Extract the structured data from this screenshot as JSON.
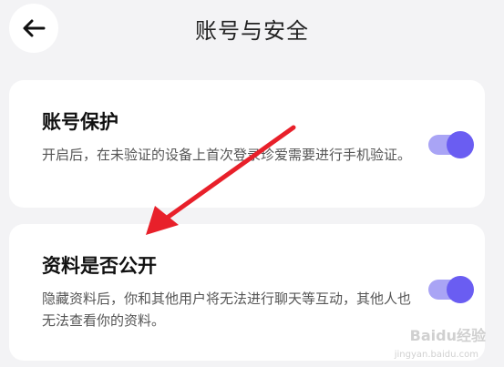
{
  "header": {
    "title": "账号与安全",
    "back_icon": "arrow-left-icon"
  },
  "settings": [
    {
      "title": "账号保护",
      "description": "开启后，在未验证的设备上首次登录珍爱需要进行手机验证。",
      "enabled": true
    },
    {
      "title": "资料是否公开",
      "description": "隐藏资料后，你和其他用户将无法进行聊天等互动，其他人也无法查看你的资料。",
      "enabled": true
    }
  ],
  "watermark": {
    "text": "Baidu经验",
    "sub": "jingyan.baidu.com"
  },
  "colors": {
    "accent": "#6a5df2",
    "track": "#a9a4f5",
    "annotation_arrow": "#e8202a"
  }
}
